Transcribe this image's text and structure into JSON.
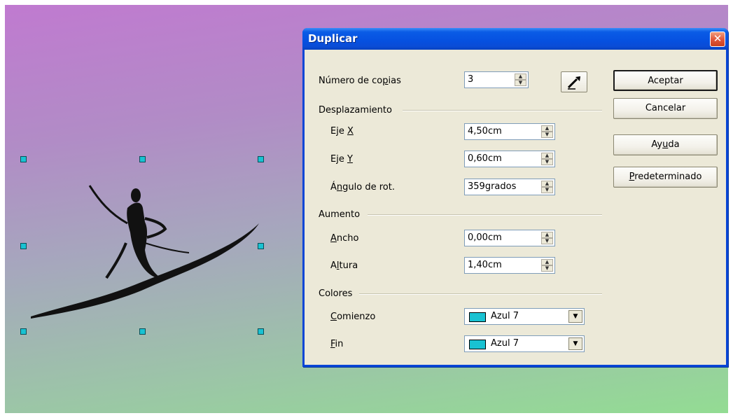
{
  "dialog": {
    "title": "Duplicar",
    "close_glyph": "✕",
    "copies": {
      "label_pre": "Número de co",
      "label_u": "p",
      "label_post": "ias",
      "value": "3"
    },
    "displacement": {
      "header": "Desplazamiento",
      "x": {
        "label_pre": "Eje ",
        "label_u": "X",
        "value": "4,50cm"
      },
      "y": {
        "label_pre": "Eje ",
        "label_u": "Y",
        "value": "0,60cm"
      },
      "angle": {
        "label_pre": "Á",
        "label_u": "n",
        "label_post": "gulo de rot.",
        "value": "359grados"
      }
    },
    "enlargement": {
      "header": "Aumento",
      "width": {
        "label_u": "A",
        "label_post": "ncho",
        "value": "0,00cm"
      },
      "height": {
        "label_pre": "A",
        "label_u": "l",
        "label_post": "tura",
        "value": "1,40cm"
      }
    },
    "colors": {
      "header": "Colores",
      "start": {
        "label_u": "C",
        "label_post": "omienzo",
        "value": "Azul 7"
      },
      "end": {
        "label_u": "F",
        "label_post": "in",
        "value": "Azul 7"
      },
      "swatch_color": "#19c2d2"
    },
    "buttons": {
      "ok": "Aceptar",
      "cancel": "Cancelar",
      "help_pre": "Ay",
      "help_u": "u",
      "help_post": "da",
      "default_u": "P",
      "default_post": "redeterminado"
    }
  },
  "colors": {
    "titlebar": "#0a5ce6",
    "selection_handle": "#19c2d2"
  },
  "icons": [
    "eyedropper-icon",
    "close-icon",
    "spin-up-icon",
    "spin-down-icon",
    "dropdown-arrow-icon"
  ]
}
